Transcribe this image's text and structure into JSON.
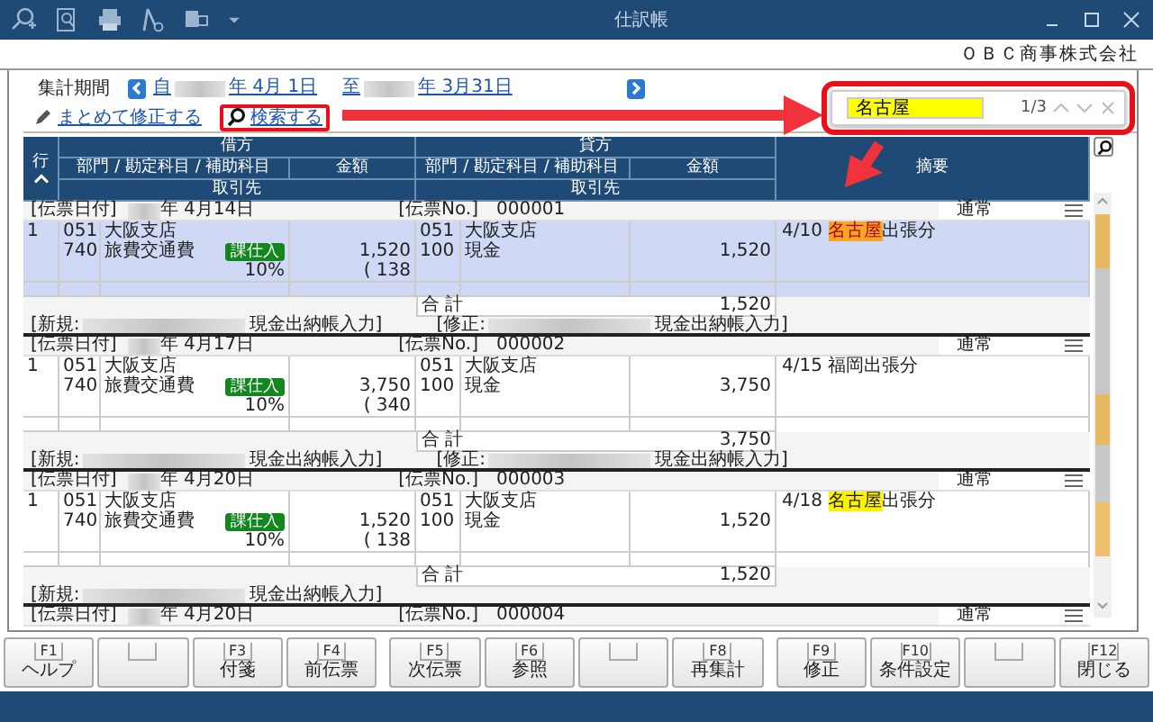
{
  "window": {
    "title": "仕訳帳",
    "company": "ＯＢＣ商事株式会社"
  },
  "period": {
    "label": "集計期間",
    "from": {
      "prefix": "自",
      "date": "年 4月 1日"
    },
    "to": {
      "prefix": "至",
      "date": "年 3月31日"
    }
  },
  "actions": [
    {
      "kind": "edit",
      "label": "まとめて修正する"
    },
    {
      "kind": "search",
      "label": "検索する"
    }
  ],
  "search_popup": {
    "value": "名古屋",
    "count": "1/3"
  },
  "table": {
    "columns": {
      "row": "行",
      "debit": "借方",
      "credit": "貸方",
      "debit_account": "部門 / 勘定科目 / 補助科目",
      "debit_amount": "金額",
      "debit_partner": "取引先",
      "credit_account": "部門 / 勘定科目 / 補助科目",
      "credit_amount": "金額",
      "credit_partner": "取引先",
      "memo": "摘要"
    },
    "vouchers": [
      {
        "date_label": "[伝票日付]",
        "date": "年 4月14日",
        "no_label": "[伝票No.]",
        "no": "000001",
        "type": "通常",
        "lines": [
          {
            "row": "1",
            "selected": true,
            "debit": {
              "dept_code": "051",
              "dept": "大阪支店",
              "account_code": "740",
              "account": "旅費交通費",
              "tax_tag": "課仕入",
              "tax_rate": "10%",
              "amount": "1,520",
              "tax": "( 138"
            },
            "credit": {
              "dept_code": "051",
              "dept": "大阪支店",
              "account_code": "100",
              "account": "現金",
              "amount": "1,520"
            },
            "memo": {
              "date": "4/10",
              "match": "名古屋",
              "after": "出張分",
              "current": true
            }
          }
        ],
        "total_label": "合 計",
        "total": "1,520",
        "created": {
          "label": "[新規:",
          "source": "現金出納帳入力]"
        },
        "modified": {
          "label": "[修正:",
          "source": "現金出納帳入力]"
        }
      },
      {
        "date_label": "[伝票日付]",
        "date": "年 4月17日",
        "no_label": "[伝票No.]",
        "no": "000002",
        "type": "通常",
        "lines": [
          {
            "row": "1",
            "selected": false,
            "debit": {
              "dept_code": "051",
              "dept": "大阪支店",
              "account_code": "740",
              "account": "旅費交通費",
              "tax_tag": "課仕入",
              "tax_rate": "10%",
              "amount": "3,750",
              "tax": "( 340"
            },
            "credit": {
              "dept_code": "051",
              "dept": "大阪支店",
              "account_code": "100",
              "account": "現金",
              "amount": "3,750"
            },
            "memo": {
              "date": "4/15",
              "text": "福岡出張分"
            }
          }
        ],
        "total_label": "合 計",
        "total": "3,750",
        "created": {
          "label": "[新規:",
          "source": "現金出納帳入力]"
        },
        "modified": {
          "label": "[修正:",
          "source": "現金出納帳入力]"
        }
      },
      {
        "date_label": "[伝票日付]",
        "date": "年 4月20日",
        "no_label": "[伝票No.]",
        "no": "000003",
        "type": "通常",
        "lines": [
          {
            "row": "1",
            "selected": false,
            "debit": {
              "dept_code": "051",
              "dept": "大阪支店",
              "account_code": "740",
              "account": "旅費交通費",
              "tax_tag": "課仕入",
              "tax_rate": "10%",
              "amount": "1,520",
              "tax": "( 138"
            },
            "credit": {
              "dept_code": "051",
              "dept": "大阪支店",
              "account_code": "100",
              "account": "現金",
              "amount": "1,520"
            },
            "memo": {
              "date": "4/18",
              "match": "名古屋",
              "after": "出張分",
              "current": false
            }
          }
        ],
        "total_label": "合 計",
        "total": "1,520",
        "created": {
          "label": "[新規:",
          "source": "現金出納帳入力]"
        }
      },
      {
        "date_label": "[伝票日付]",
        "date": "年 4月20日",
        "no_label": "[伝票No.]",
        "no": "000004",
        "type": "通常"
      }
    ]
  },
  "function_keys": [
    {
      "kind": "key",
      "key": "F1",
      "label": "ヘルプ"
    },
    {
      "kind": "blank"
    },
    {
      "kind": "key",
      "key": "F3",
      "label": "付箋"
    },
    {
      "kind": "key",
      "key": "F4",
      "label": "前伝票"
    },
    {
      "kind": "key",
      "key": "F5",
      "label": "次伝票"
    },
    {
      "kind": "key",
      "key": "F6",
      "label": "参照"
    },
    {
      "kind": "blank"
    },
    {
      "kind": "key",
      "key": "F8",
      "label": "再集計"
    },
    {
      "kind": "key",
      "key": "F9",
      "label": "修正"
    },
    {
      "kind": "key",
      "key": "F10",
      "label": "条件設定"
    },
    {
      "kind": "blank"
    },
    {
      "kind": "key",
      "key": "F12",
      "label": "閉じる"
    }
  ]
}
